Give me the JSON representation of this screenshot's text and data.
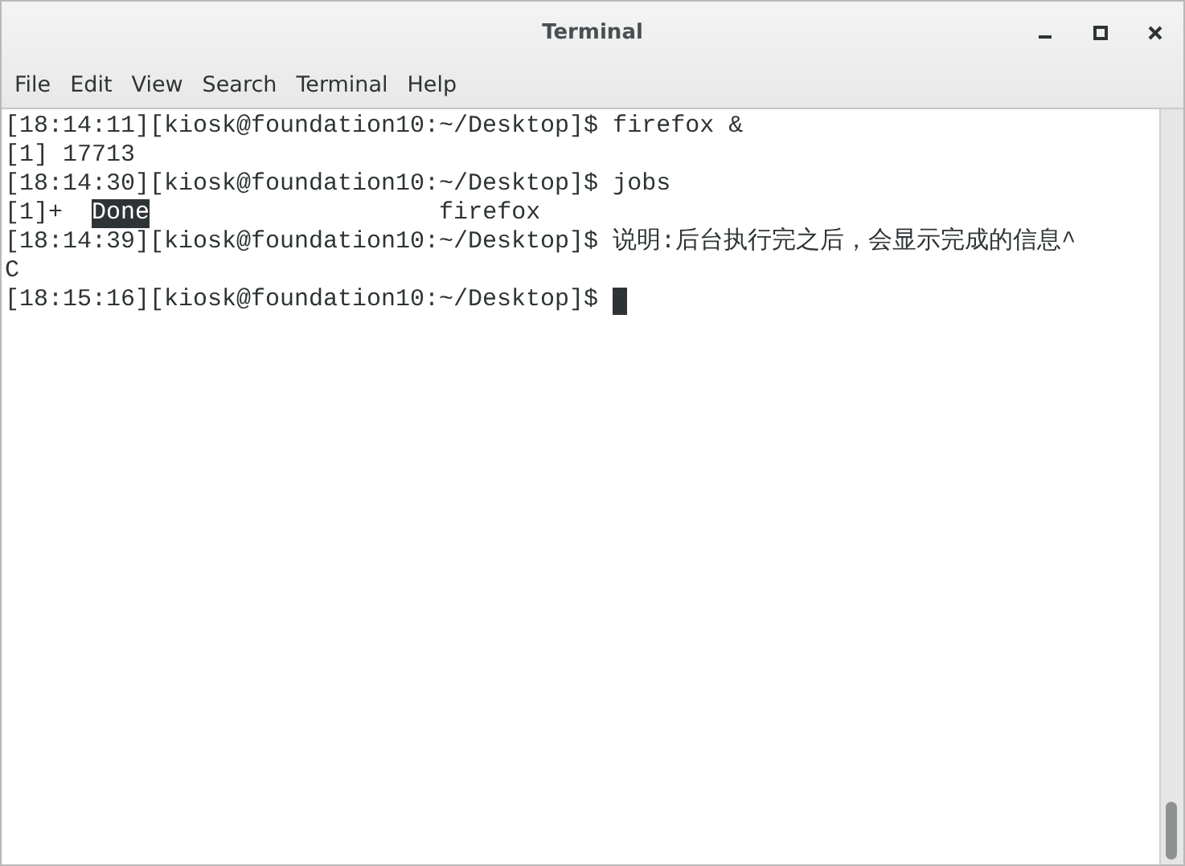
{
  "window": {
    "title": "Terminal"
  },
  "menu": [
    "File",
    "Edit",
    "View",
    "Search",
    "Terminal",
    "Help"
  ],
  "lines": [
    {
      "segments": [
        {
          "text": "[18:14:11][kiosk@foundation10:~/Desktop]$ firefox &",
          "highlighted": false
        }
      ],
      "cursor": false
    },
    {
      "segments": [
        {
          "text": "[1] 17713",
          "highlighted": false
        }
      ],
      "cursor": false
    },
    {
      "segments": [
        {
          "text": "[18:14:30][kiosk@foundation10:~/Desktop]$ jobs",
          "highlighted": false
        }
      ],
      "cursor": false
    },
    {
      "segments": [
        {
          "text": "[1]+  ",
          "highlighted": false
        },
        {
          "text": "Done",
          "highlighted": true
        },
        {
          "text": "                    firefox",
          "highlighted": false
        }
      ],
      "cursor": false
    },
    {
      "segments": [
        {
          "text": "[18:14:39][kiosk@foundation10:~/Desktop]$ 说明:后台执行完之后，会显示完成的信息^",
          "highlighted": false
        }
      ],
      "cursor": false
    },
    {
      "segments": [
        {
          "text": "C",
          "highlighted": false
        }
      ],
      "cursor": false
    },
    {
      "segments": [
        {
          "text": "[18:15:16][kiosk@foundation10:~/Desktop]$ ",
          "highlighted": false
        }
      ],
      "cursor": true
    }
  ]
}
